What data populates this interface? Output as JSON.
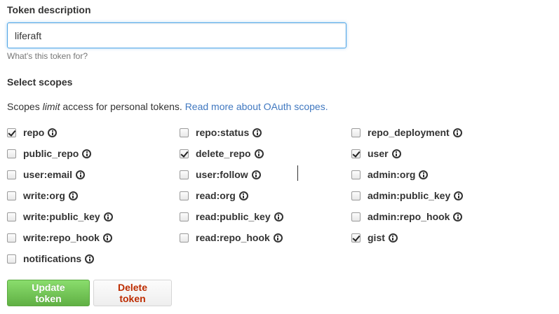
{
  "token": {
    "title": "Token description",
    "value": "liferaft",
    "hint": "What's this token for?"
  },
  "scopes": {
    "title": "Select scopes",
    "desc_prefix": "Scopes ",
    "desc_emphasis": "limit",
    "desc_middle": " access for personal tokens. ",
    "desc_link": "Read more about OAuth scopes.",
    "items": [
      {
        "label": "repo",
        "checked": true
      },
      {
        "label": "repo:status",
        "checked": false
      },
      {
        "label": "repo_deployment",
        "checked": false
      },
      {
        "label": "public_repo",
        "checked": false
      },
      {
        "label": "delete_repo",
        "checked": true
      },
      {
        "label": "user",
        "checked": true
      },
      {
        "label": "user:email",
        "checked": false
      },
      {
        "label": "user:follow",
        "checked": false
      },
      {
        "label": "admin:org",
        "checked": false
      },
      {
        "label": "write:org",
        "checked": false
      },
      {
        "label": "read:org",
        "checked": false
      },
      {
        "label": "admin:public_key",
        "checked": false
      },
      {
        "label": "write:public_key",
        "checked": false
      },
      {
        "label": "read:public_key",
        "checked": false
      },
      {
        "label": "admin:repo_hook",
        "checked": false
      },
      {
        "label": "write:repo_hook",
        "checked": false
      },
      {
        "label": "read:repo_hook",
        "checked": false
      },
      {
        "label": "gist",
        "checked": true
      },
      {
        "label": "notifications",
        "checked": false
      }
    ]
  },
  "actions": {
    "update_label": "Update token",
    "delete_label": "Delete token"
  }
}
